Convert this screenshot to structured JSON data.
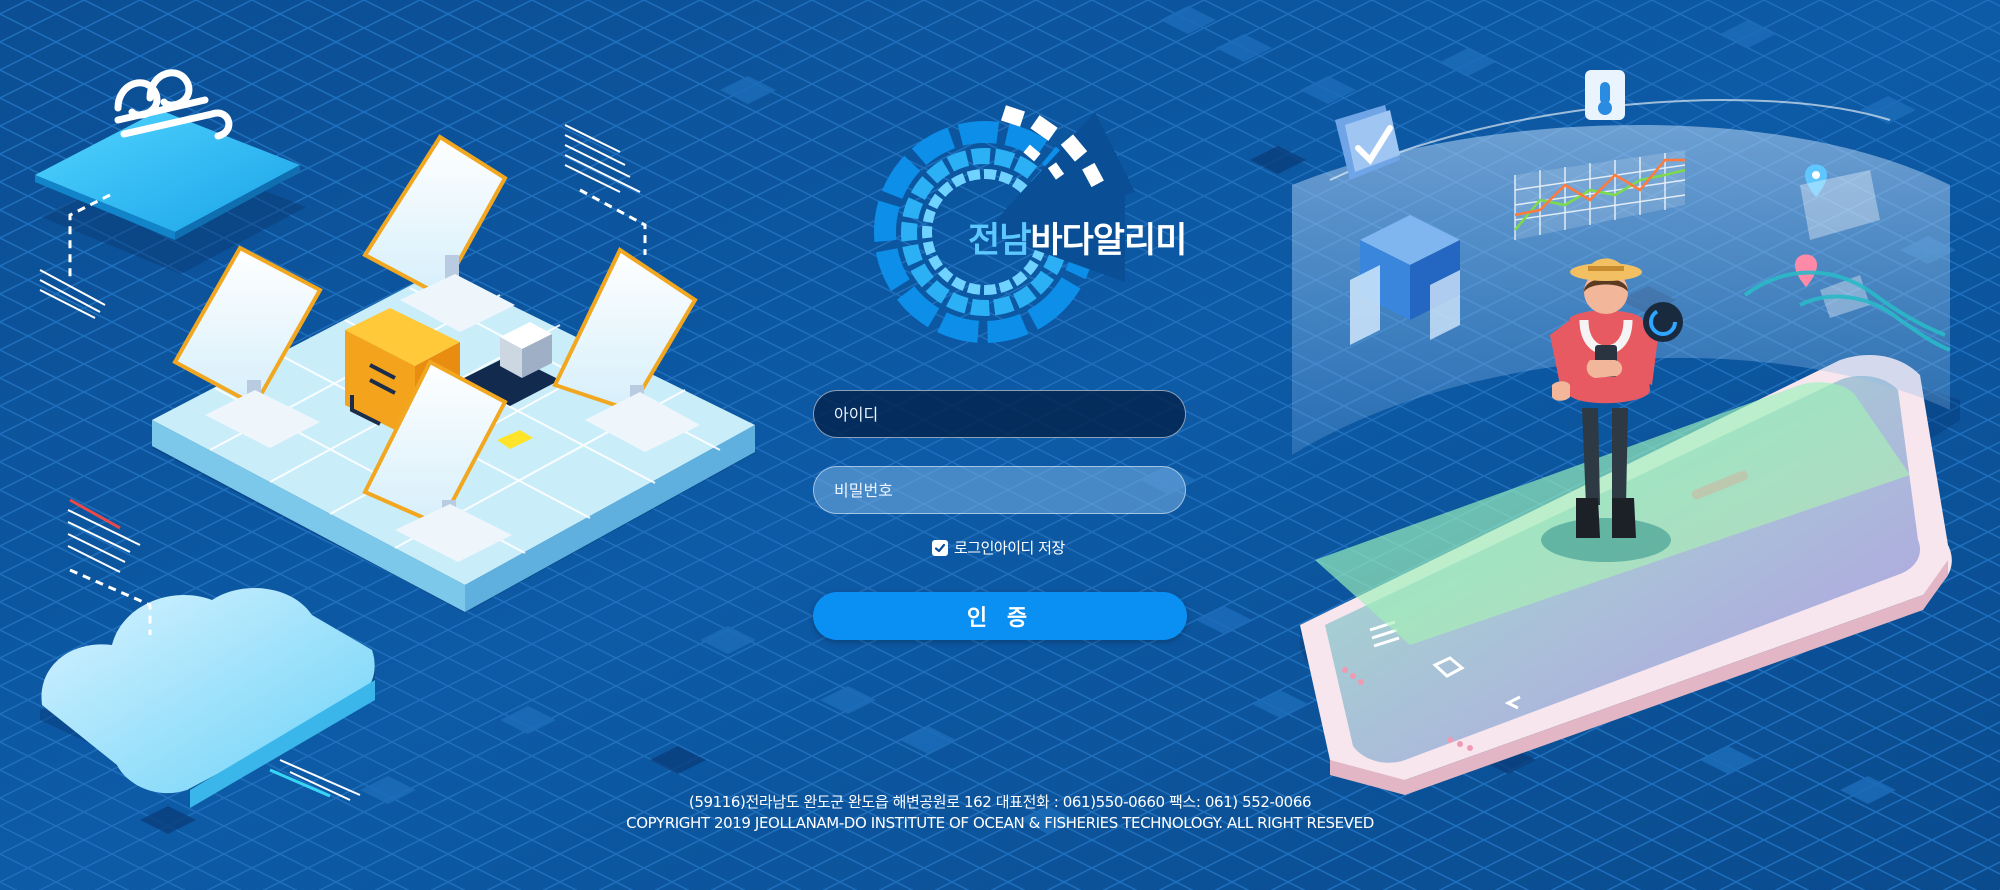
{
  "brand": {
    "name": "전남바다알리미",
    "name_prefix": "전남",
    "name_suffix": "바다알리미"
  },
  "login": {
    "id_placeholder": "아이디",
    "password_placeholder": "비밀번호",
    "remember_label": "로그인아이디 저장",
    "remember_checked": true,
    "submit_label": "인 증"
  },
  "footer": {
    "address_line": "(59116)전라남도 완도군 완도읍 해변공원로 162   대표전화 : 061)550-0660  팩스: 061) 552-0066",
    "copyright_line": "COPYRIGHT 2019 JEOLLANAM-DO INSTITUTE OF OCEAN & FISHERIES TECHNOLOGY.  ALL RIGHT RESEVED"
  },
  "colors": {
    "background": "#0a4f95",
    "button": "#0a8ff2",
    "logo_accent": "#5cc8ff",
    "field_dark": "#022048"
  },
  "icons": {
    "check": "check-icon",
    "weather": "wind-icon",
    "thermometer": "thermometer-icon",
    "chart": "line-chart-icon",
    "location": "map-pin-icon"
  }
}
